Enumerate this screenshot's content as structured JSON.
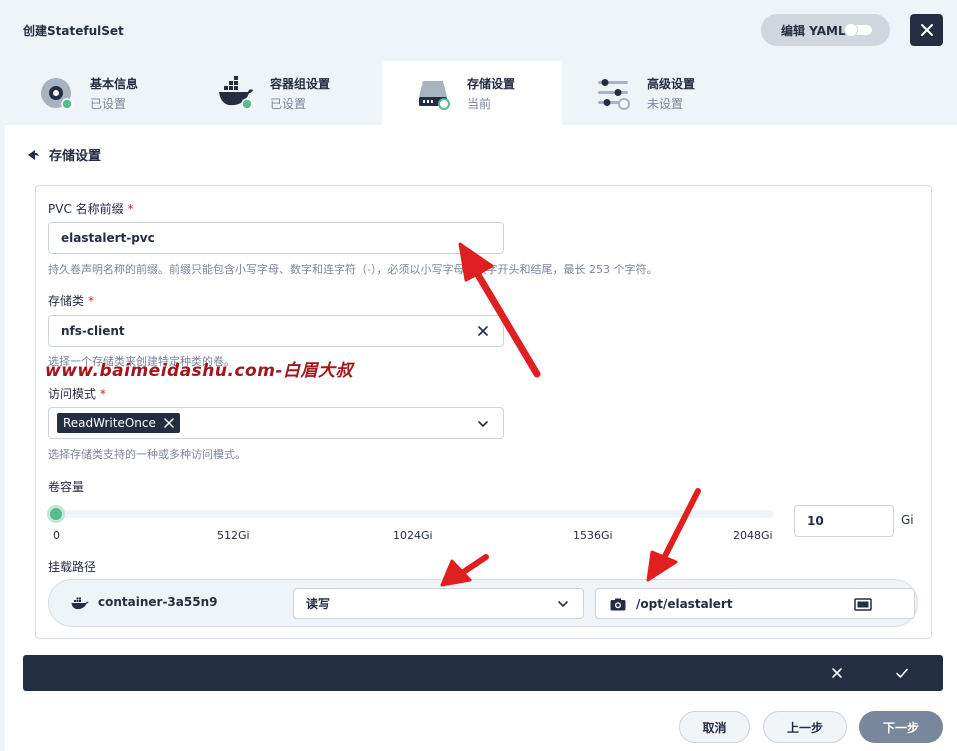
{
  "dialog": {
    "title": "创建StatefulSet",
    "edit_yaml_label": "编辑 YAML"
  },
  "steps": [
    {
      "title": "基本信息",
      "status": "已设置"
    },
    {
      "title": "容器组设置",
      "status": "已设置"
    },
    {
      "title": "存储设置",
      "status": "当前"
    },
    {
      "title": "高级设置",
      "status": "未设置"
    }
  ],
  "section": {
    "title": "存储设置"
  },
  "form": {
    "pvc_prefix": {
      "label": "PVC 名称前缀",
      "value": "elastalert-pvc",
      "hint": "持久卷声明名称的前缀。前缀只能包含小写字母、数字和连字符（-），必须以小写字母或数字开头和结尾，最长 253 个字符。"
    },
    "storage_class": {
      "label": "存储类",
      "value": "nfs-client",
      "hint": "选择一个存储类来创建特定种类的卷。"
    },
    "access_mode": {
      "label": "访问模式",
      "value": "ReadWriteOnce",
      "hint": "选择存储类支持的一种或多种访问模式。"
    },
    "volume_capacity": {
      "label": "卷容量",
      "ticks": [
        "0",
        "512Gi",
        "1024Gi",
        "1536Gi",
        "2048Gi"
      ],
      "value": "10",
      "unit": "Gi"
    },
    "mount_path": {
      "label": "挂载路径",
      "container_name": "container-3a55n9",
      "mode": "读写",
      "path": "/opt/elastalert"
    }
  },
  "footer": {
    "cancel": "取消",
    "previous": "上一步",
    "next": "下一步"
  },
  "watermark": "www.baimeidashu.com-白眉大叔",
  "colors": {
    "primary_dark": "#242e42",
    "success": "#55bc8a",
    "background": "#eff4f9",
    "annotation_red": "#e02020"
  }
}
